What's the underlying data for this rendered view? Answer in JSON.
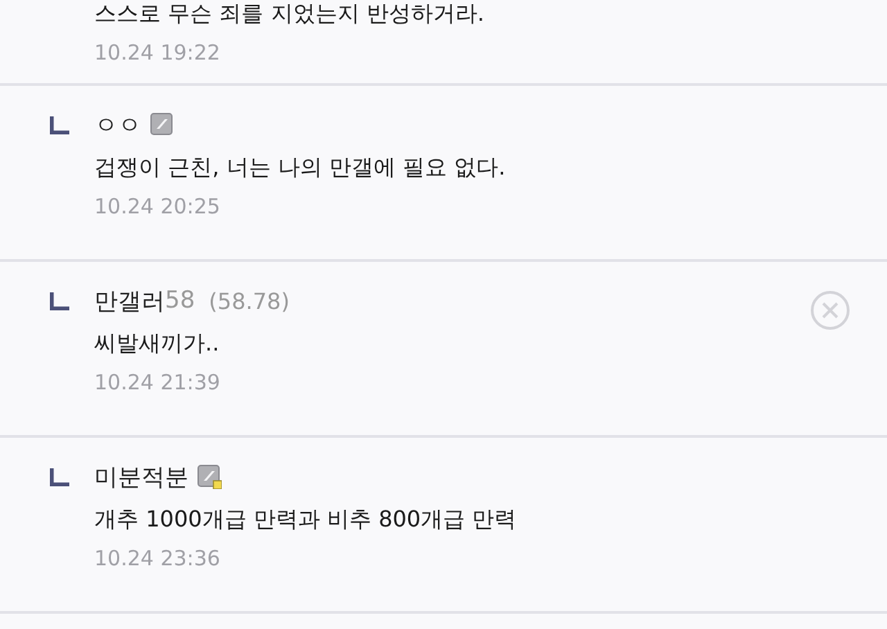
{
  "comments": [
    {
      "kind": "cut",
      "text": "스스로 무슨 죄를 지었는지 반성하거라.",
      "date": "10.24 19:22"
    },
    {
      "kind": "reply",
      "nickname": "ㅇㅇ",
      "badge": {
        "kind": "fixed"
      },
      "text": "겁쟁이 근친, 너는 나의 만갤에 필요 없다.",
      "date": "10.24 20:25",
      "deletable": false
    },
    {
      "kind": "reply",
      "nickname": "만갤러",
      "nick_suffix": "58",
      "ip": "(58.78)",
      "text": "씨발새끼가..",
      "date": "10.24 21:39",
      "deletable": true
    },
    {
      "kind": "reply",
      "nickname": "미분적분",
      "badge": {
        "kind": "semi"
      },
      "text": "개추 1000개급 만력과 비추 800개급 만력",
      "date": "10.24 23:36",
      "deletable": false
    }
  ]
}
